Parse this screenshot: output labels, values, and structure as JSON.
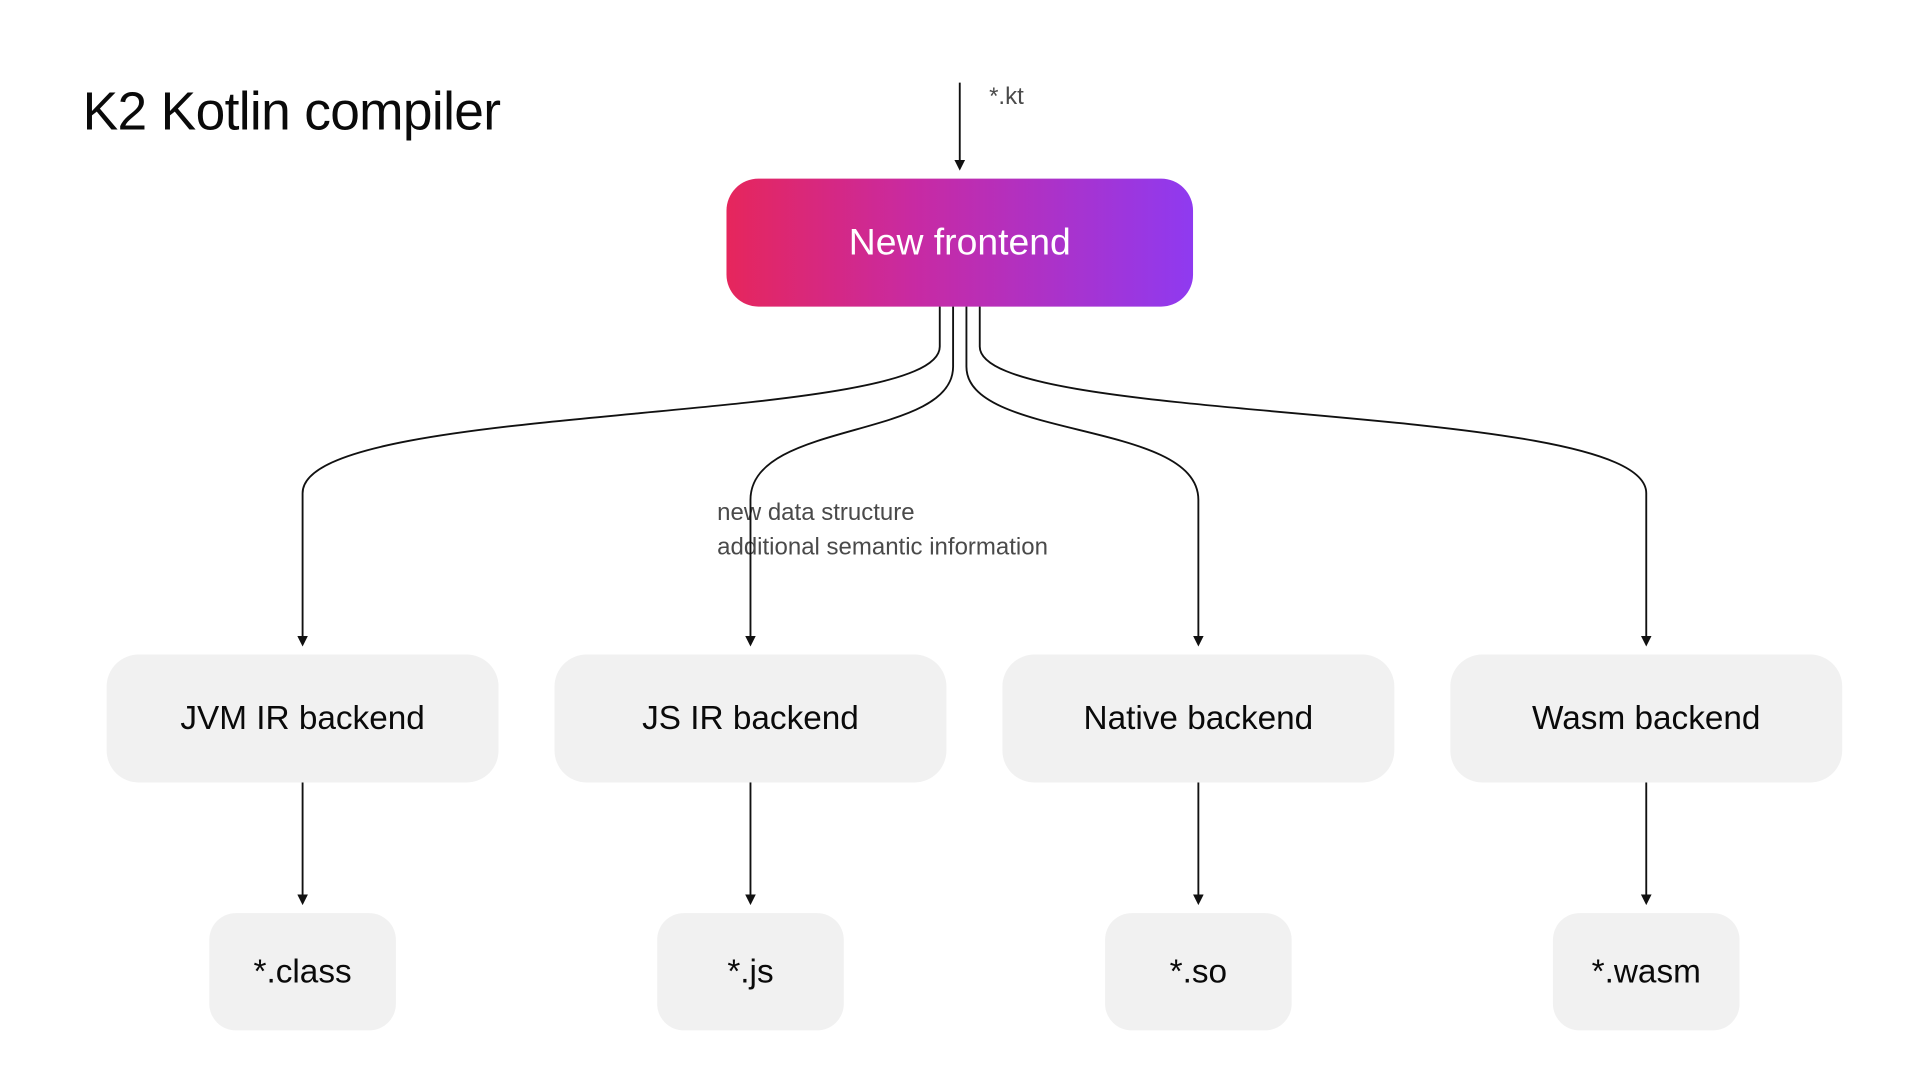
{
  "title": "K2 Kotlin compiler",
  "input_label": "*.kt",
  "frontend_label": "New frontend",
  "annotation_line1": "new data structure",
  "annotation_line2": "additional semantic information",
  "backends": [
    {
      "label": "JVM IR backend",
      "output": "*.class"
    },
    {
      "label": "JS IR backend",
      "output": "*.js"
    },
    {
      "label": "Native backend",
      "output": "*.so"
    },
    {
      "label": "Wasm backend",
      "output": "*.wasm"
    }
  ],
  "chart_data": {
    "type": "flowchart",
    "title": "K2 Kotlin compiler",
    "nodes": [
      {
        "id": "input",
        "label": "*.kt",
        "kind": "label"
      },
      {
        "id": "frontend",
        "label": "New frontend",
        "kind": "process",
        "highlight": true
      },
      {
        "id": "jvm",
        "label": "JVM IR backend",
        "kind": "process"
      },
      {
        "id": "js",
        "label": "JS IR backend",
        "kind": "process"
      },
      {
        "id": "native",
        "label": "Native backend",
        "kind": "process"
      },
      {
        "id": "wasm",
        "label": "Wasm backend",
        "kind": "process"
      },
      {
        "id": "out_jvm",
        "label": "*.class",
        "kind": "output"
      },
      {
        "id": "out_js",
        "label": "*.js",
        "kind": "output"
      },
      {
        "id": "out_native",
        "label": "*.so",
        "kind": "output"
      },
      {
        "id": "out_wasm",
        "label": "*.wasm",
        "kind": "output"
      }
    ],
    "edges": [
      {
        "from": "input",
        "to": "frontend"
      },
      {
        "from": "frontend",
        "to": "jvm",
        "annotation": "new data structure; additional semantic information"
      },
      {
        "from": "frontend",
        "to": "js",
        "annotation": "new data structure; additional semantic information"
      },
      {
        "from": "frontend",
        "to": "native",
        "annotation": "new data structure; additional semantic information"
      },
      {
        "from": "frontend",
        "to": "wasm",
        "annotation": "new data structure; additional semantic information"
      },
      {
        "from": "jvm",
        "to": "out_jvm"
      },
      {
        "from": "js",
        "to": "out_js"
      },
      {
        "from": "native",
        "to": "out_native"
      },
      {
        "from": "wasm",
        "to": "out_wasm"
      }
    ]
  }
}
